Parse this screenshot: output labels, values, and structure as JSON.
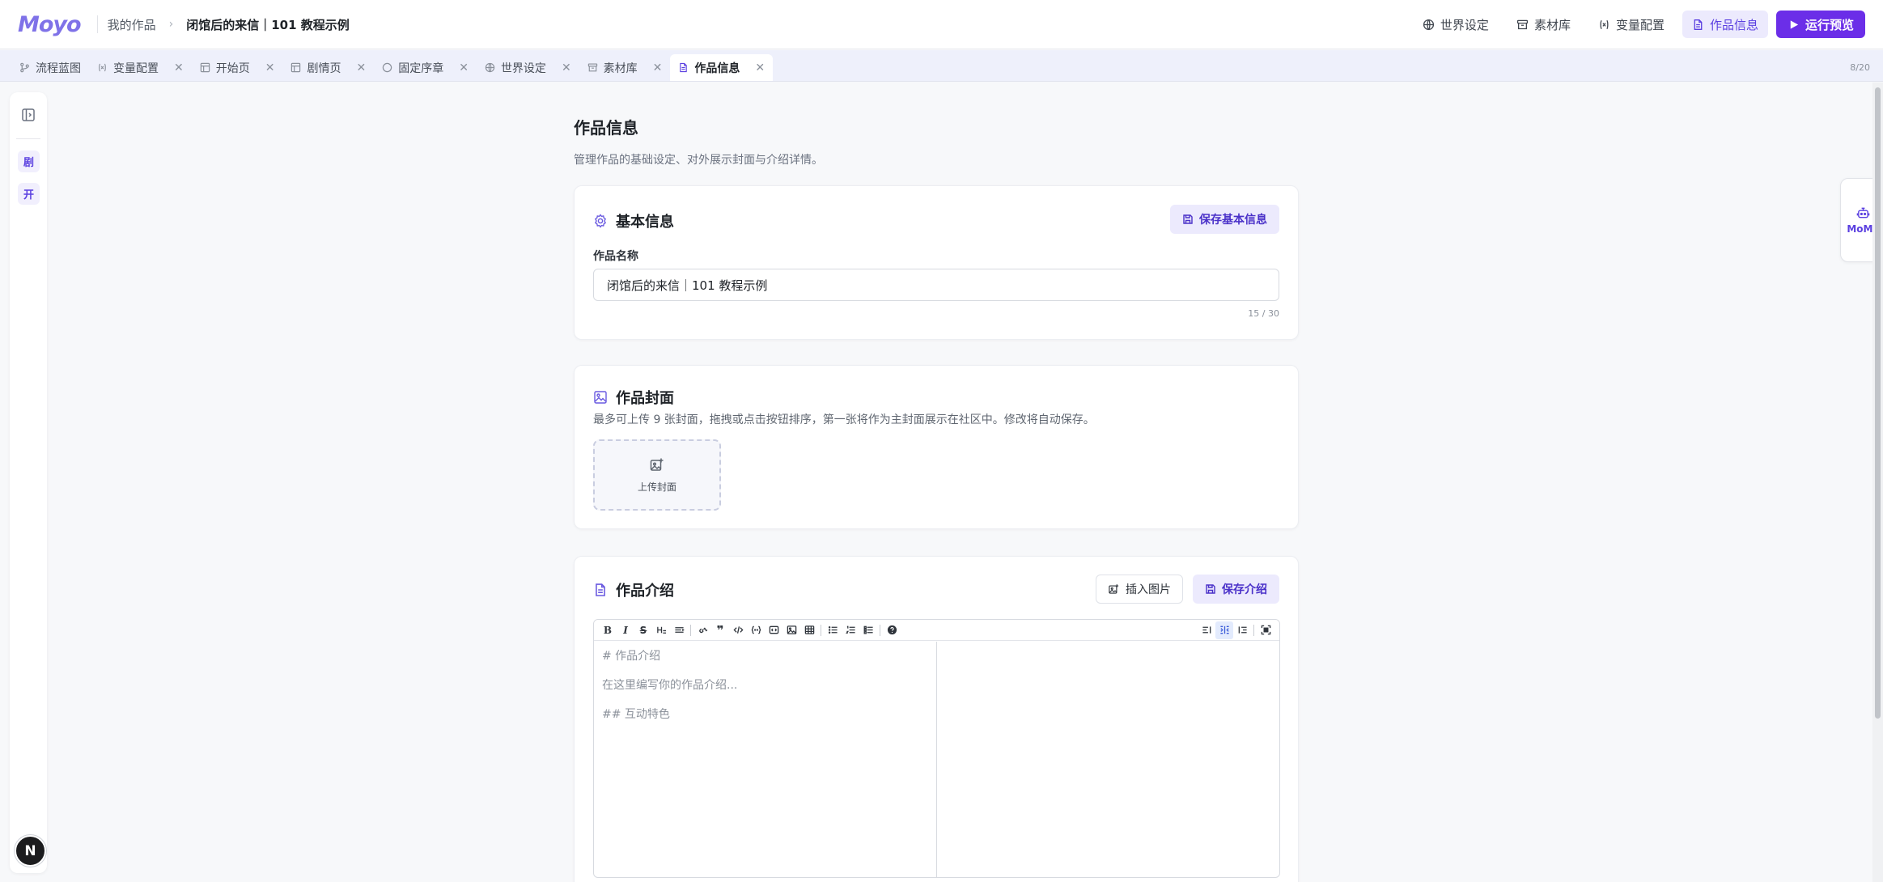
{
  "header": {
    "logo": "Moyo",
    "breadcrumb_root": "我的作品",
    "breadcrumb_current": "闭馆后的来信｜101 教程示例",
    "actions": [
      {
        "label": "世界设定",
        "icon": "globe-icon"
      },
      {
        "label": "素材库",
        "icon": "archive-icon"
      },
      {
        "label": "变量配置",
        "icon": "variable-icon"
      },
      {
        "label": "作品信息",
        "icon": "document-icon",
        "active": true
      }
    ],
    "run_label": "运行预览"
  },
  "tabs": [
    {
      "label": "流程蓝图",
      "icon": "flow-icon",
      "closable": false
    },
    {
      "label": "变量配置",
      "icon": "variable-icon",
      "closable": true
    },
    {
      "label": "开始页",
      "icon": "layout-icon",
      "closable": true
    },
    {
      "label": "剧情页",
      "icon": "layout-icon",
      "closable": true
    },
    {
      "label": "固定序章",
      "icon": "circle-icon",
      "closable": true
    },
    {
      "label": "世界设定",
      "icon": "globe-icon",
      "closable": true
    },
    {
      "label": "素材库",
      "icon": "archive-icon",
      "closable": true
    },
    {
      "label": "作品信息",
      "icon": "document-icon",
      "closable": true,
      "active": true
    }
  ],
  "tab_count": "8/20",
  "sidebar": {
    "chips": [
      "剧",
      "开"
    ],
    "avatar": "N"
  },
  "page": {
    "title": "作品信息",
    "subtitle": "管理作品的基础设定、对外展示封面与介绍详情。"
  },
  "basic": {
    "title": "基本信息",
    "save_label": "保存基本信息",
    "name_label": "作品名称",
    "name_value": "闭馆后的来信｜101 教程示例",
    "counter": "15 / 30"
  },
  "cover": {
    "title": "作品封面",
    "hint": "最多可上传 9 张封面，拖拽或点击按钮排序，第一张将作为主封面展示在社区中。修改将自动保存。",
    "upload_label": "上传封面"
  },
  "intro": {
    "title": "作品介绍",
    "insert_image_label": "插入图片",
    "save_label": "保存介绍",
    "placeholder_lines": [
      "# 作品介绍",
      "在这里编写你的作品介绍...",
      "## 互动特色"
    ]
  },
  "momo": {
    "label": "MoMo"
  },
  "colors": {
    "accent": "#6b2ee8",
    "accent_soft": "#eceafd",
    "logo": "#7f72e8"
  }
}
